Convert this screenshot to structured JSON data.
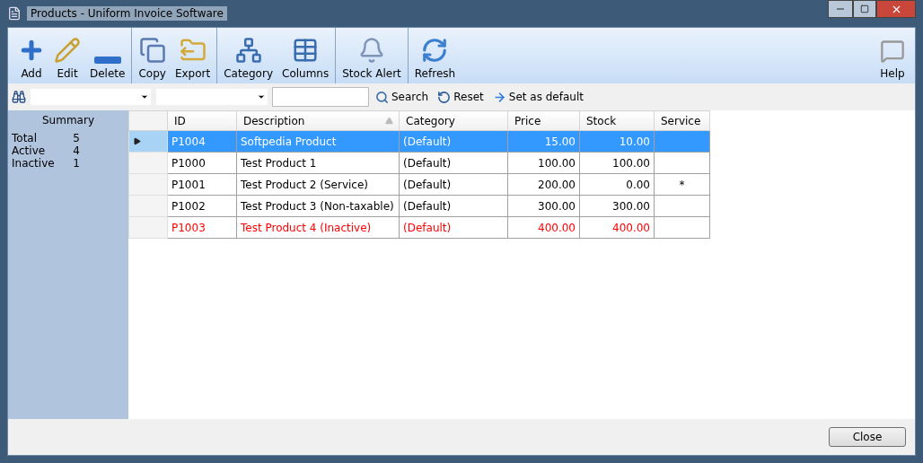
{
  "window": {
    "title": "Products - Uniform Invoice Software"
  },
  "toolbar": {
    "groups": [
      [
        {
          "label": "Add"
        },
        {
          "label": "Edit"
        },
        {
          "label": "Delete"
        }
      ],
      [
        {
          "label": "Copy"
        },
        {
          "label": "Export"
        }
      ],
      [
        {
          "label": "Category"
        },
        {
          "label": "Columns"
        }
      ],
      [
        {
          "label": "Stock Alert"
        }
      ],
      [
        {
          "label": "Refresh"
        }
      ]
    ],
    "help": {
      "label": "Help"
    }
  },
  "filter_bar": {
    "actions": [
      {
        "label": "Search"
      },
      {
        "label": "Reset"
      },
      {
        "label": "Set as default"
      }
    ]
  },
  "summary": {
    "title": "Summary",
    "rows": [
      {
        "label": "Total",
        "value": "5"
      },
      {
        "label": "Active",
        "value": "4"
      },
      {
        "label": "Inactive",
        "value": "1"
      }
    ]
  },
  "table": {
    "columns": [
      {
        "label": "ID",
        "kind": "text",
        "sorted": false
      },
      {
        "label": "Description",
        "kind": "text",
        "sorted": true
      },
      {
        "label": "Category",
        "kind": "text",
        "sorted": false
      },
      {
        "label": "Price",
        "kind": "number",
        "sorted": false
      },
      {
        "label": "Stock",
        "kind": "number",
        "sorted": false
      },
      {
        "label": "Service",
        "kind": "flag",
        "sorted": false
      }
    ],
    "rows": [
      {
        "selected": true,
        "inactive": false,
        "cells": [
          "P1004",
          "Softpedia Product",
          "(Default)",
          "15.00",
          "10.00",
          ""
        ]
      },
      {
        "selected": false,
        "inactive": false,
        "cells": [
          "P1000",
          "Test Product 1",
          "(Default)",
          "100.00",
          "100.00",
          ""
        ]
      },
      {
        "selected": false,
        "inactive": false,
        "cells": [
          "P1001",
          "Test Product 2 (Service)",
          "(Default)",
          "200.00",
          "0.00",
          "*"
        ]
      },
      {
        "selected": false,
        "inactive": false,
        "cells": [
          "P1002",
          "Test Product 3 (Non-taxable)",
          "(Default)",
          "300.00",
          "300.00",
          ""
        ]
      },
      {
        "selected": false,
        "inactive": true,
        "cells": [
          "P1003",
          "Test Product 4 (Inactive)",
          "(Default)",
          "400.00",
          "400.00",
          ""
        ]
      }
    ]
  },
  "buttons": [
    "Close"
  ]
}
